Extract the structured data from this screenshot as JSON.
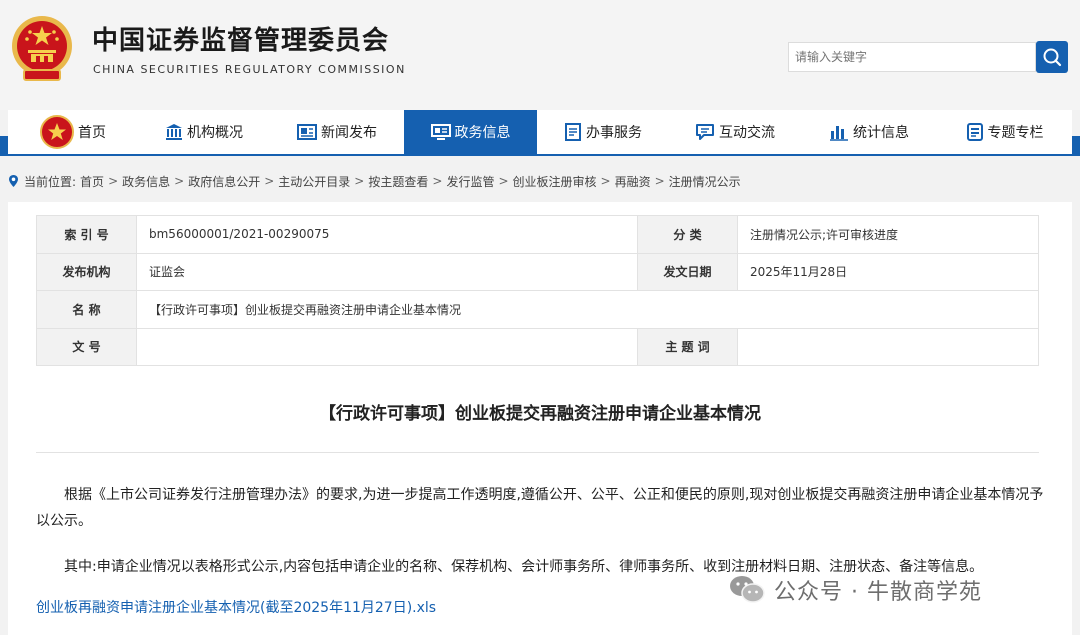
{
  "header": {
    "title_cn": "中国证券监督管理委员会",
    "title_en": "CHINA SECURITIES REGULATORY COMMISSION",
    "search_placeholder": "请输入关键字"
  },
  "nav": {
    "items": [
      {
        "label": "首页",
        "icon": "emblem-icon"
      },
      {
        "label": "机构概况",
        "icon": "building-icon"
      },
      {
        "label": "新闻发布",
        "icon": "newspaper-icon"
      },
      {
        "label": "政务信息",
        "icon": "monitor-icon",
        "active": true
      },
      {
        "label": "办事服务",
        "icon": "document-list-icon"
      },
      {
        "label": "互动交流",
        "icon": "chat-icon"
      },
      {
        "label": "统计信息",
        "icon": "bar-chart-icon"
      },
      {
        "label": "专题专栏",
        "icon": "folder-icon"
      }
    ]
  },
  "breadcrumb": {
    "prefix": "当前位置:",
    "items": [
      "首页",
      "政务信息",
      "政府信息公开",
      "主动公开目录",
      "按主题查看",
      "发行监管",
      "创业板注册审核",
      "再融资",
      "注册情况公示"
    ]
  },
  "meta": {
    "index_label": "索 引 号",
    "index_value": "bm56000001/2021-00290075",
    "category_label": "分      类",
    "category_value": "注册情况公示;许可审核进度",
    "issuer_label": "发布机构",
    "issuer_value": "证监会",
    "date_label": "发文日期",
    "date_value": "2025年11月28日",
    "name_label": "名      称",
    "name_value": "【行政许可事项】创业板提交再融资注册申请企业基本情况",
    "docno_label": "文      号",
    "docno_value": "",
    "subject_label": "主 题 词",
    "subject_value": ""
  },
  "article": {
    "title": "【行政许可事项】创业板提交再融资注册申请企业基本情况",
    "para1": "根据《上市公司证券发行注册管理办法》的要求,为进一步提高工作透明度,遵循公开、公平、公正和便民的原则,现对创业板提交再融资注册申请企业基本情况予以公示。",
    "para2": "其中:申请企业情况以表格形式公示,内容包括申请企业的名称、保荐机构、会计师事务所、律师事务所、收到注册材料日期、注册状态、备注等信息。",
    "attachment": "创业板再融资申请注册企业基本情况(截至2025年11月27日).xls"
  },
  "watermark": {
    "text": "公众号 · 牛散商学苑",
    "icon": "wechat-icon"
  },
  "colors": {
    "brand_blue": "#1560b0",
    "emblem_red": "#c9141b",
    "emblem_gold": "#e9b84b"
  }
}
